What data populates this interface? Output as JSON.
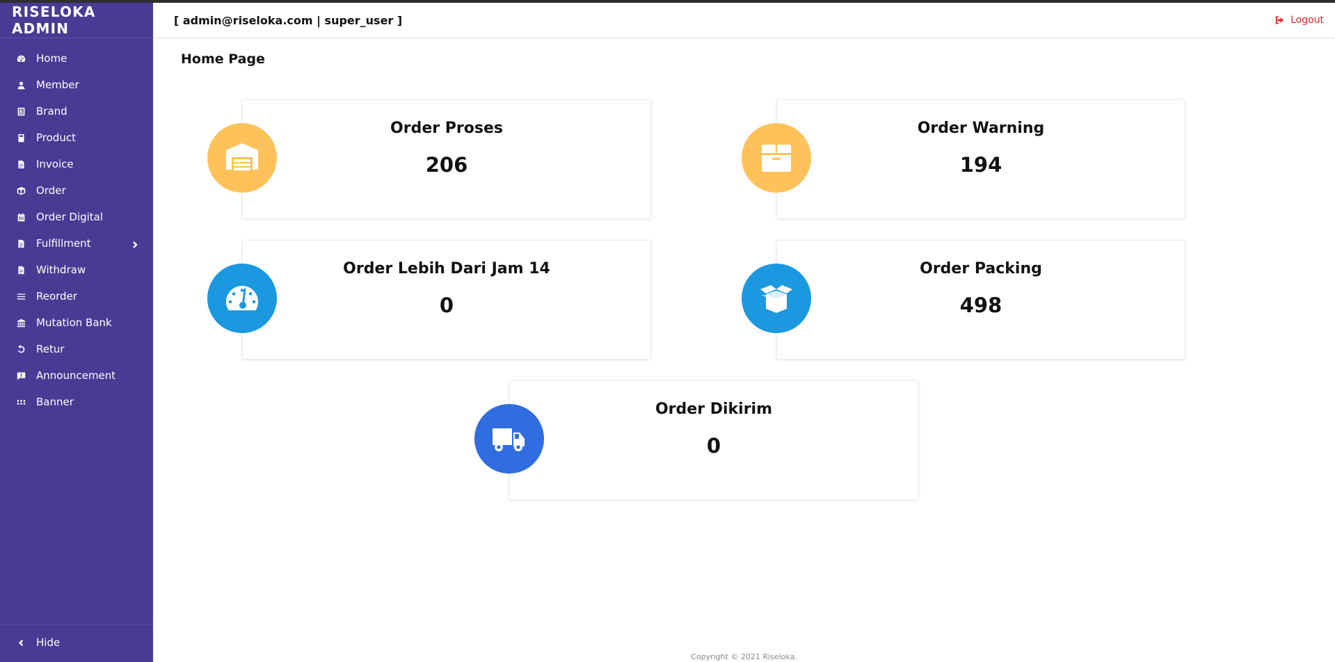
{
  "app": {
    "title": "RISELOKA ADMIN"
  },
  "header": {
    "user_info": "[ admin@riseloka.com | super_user ]",
    "logout_label": "Logout"
  },
  "sidebar": {
    "items": [
      {
        "label": "Home",
        "icon": "dashboard-icon"
      },
      {
        "label": "Member",
        "icon": "user-icon"
      },
      {
        "label": "Brand",
        "icon": "brand-icon"
      },
      {
        "label": "Product",
        "icon": "book-icon"
      },
      {
        "label": "Invoice",
        "icon": "document-icon"
      },
      {
        "label": "Order",
        "icon": "box-icon"
      },
      {
        "label": "Order Digital",
        "icon": "calendar-icon"
      },
      {
        "label": "Fulfillment",
        "icon": "document-icon",
        "has_submenu": true
      },
      {
        "label": "Withdraw",
        "icon": "document-icon"
      },
      {
        "label": "Reorder",
        "icon": "list-icon"
      },
      {
        "label": "Mutation Bank",
        "icon": "bank-icon"
      },
      {
        "label": "Retur",
        "icon": "return-icon"
      },
      {
        "label": "Announcement",
        "icon": "announcement-icon"
      },
      {
        "label": "Banner",
        "icon": "grid-icon"
      }
    ],
    "hide_label": "Hide"
  },
  "main": {
    "page_title": "Home Page",
    "cards": [
      {
        "title": "Order Proses",
        "value": "206",
        "icon": "warehouse-icon",
        "color": "#ffc25a"
      },
      {
        "title": "Order Warning",
        "value": "194",
        "icon": "package-icon",
        "color": "#ffc25a"
      },
      {
        "title": "Order Lebih Dari Jam 14",
        "value": "0",
        "icon": "speedometer-icon",
        "color": "#1b98df"
      },
      {
        "title": "Order Packing",
        "value": "498",
        "icon": "open-box-icon",
        "color": "#1b98df"
      },
      {
        "title": "Order Dikirim",
        "value": "0",
        "icon": "truck-icon",
        "color": "#2f6de0"
      }
    ]
  },
  "footer": {
    "copyright": "Copyright © 2021 Riseloka."
  },
  "colors": {
    "sidebar_bg": "#4a3a94",
    "logout": "#e02424"
  }
}
